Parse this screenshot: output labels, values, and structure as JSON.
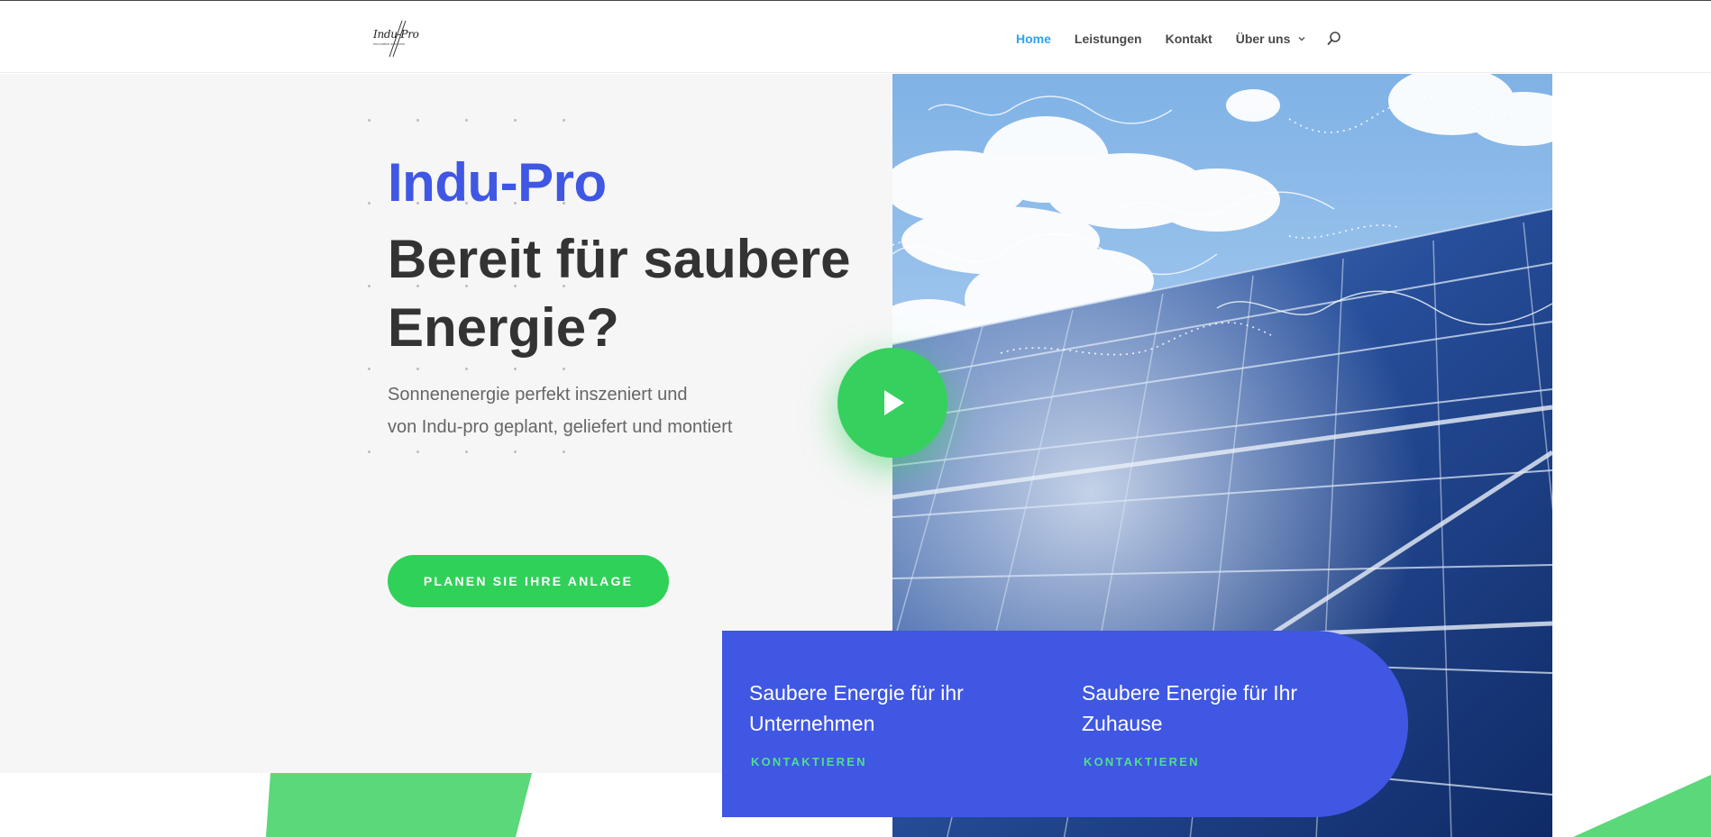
{
  "header": {
    "logo": {
      "title": "Indu-Pro",
      "subtitle": "innovative solutions"
    },
    "nav": [
      {
        "label": "Home",
        "active": true
      },
      {
        "label": "Leistungen",
        "active": false
      },
      {
        "label": "Kontakt",
        "active": false
      },
      {
        "label": "Über uns",
        "active": false,
        "dropdown": true
      }
    ],
    "search_icon": "search-icon"
  },
  "hero": {
    "brand": "Indu-Pro",
    "headline": "Bereit für saubere Energie?",
    "subtitle_line1": "Sonnenenergie perfekt inszeniert und",
    "subtitle_line2": "von Indu-pro geplant, geliefert und montiert",
    "cta_label": "PLANEN SIE IHRE ANLAGE"
  },
  "media": {
    "image": "solar-panels-under-blue-sky",
    "play_icon": "play-icon"
  },
  "cards": [
    {
      "title": "Saubere Energie für ihr Unternehmen",
      "link": "KONTAKTIEREN"
    },
    {
      "title": "Saubere Energie für Ihr Zuhause",
      "link": "KONTAKTIEREN"
    }
  ],
  "colors": {
    "brand_blue": "#3f57e3",
    "accent_green": "#30d158",
    "nav_active": "#2ea3f2",
    "card_link_green": "#4fe08a",
    "hero_bg": "#f6f6f6"
  }
}
